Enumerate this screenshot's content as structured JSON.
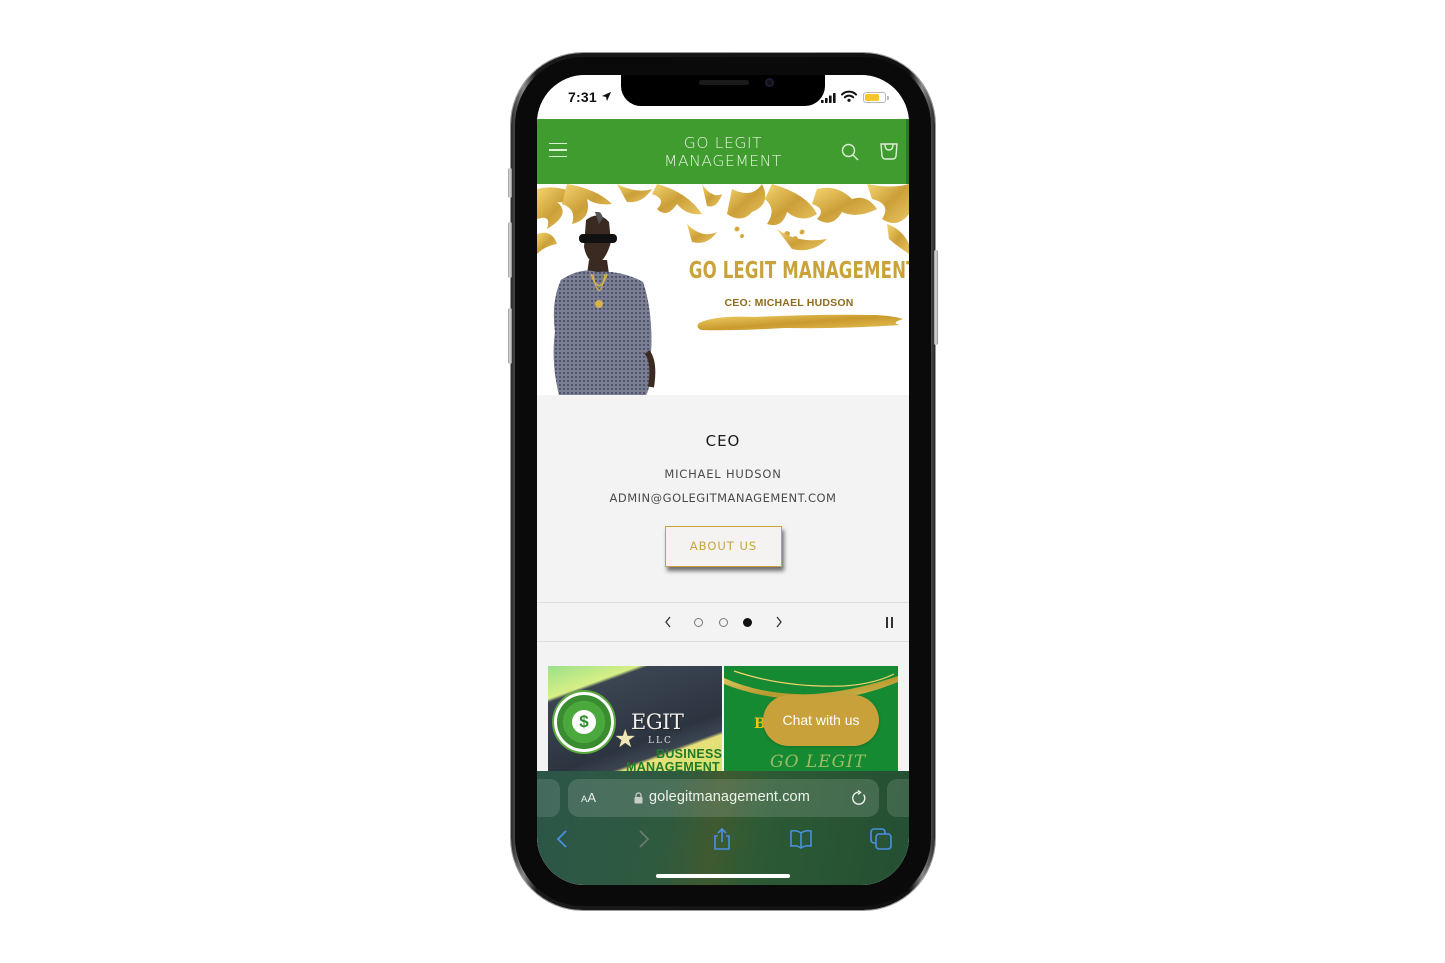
{
  "status_bar": {
    "time": "7:31",
    "location_icon": "location-arrow-icon",
    "signal_icon": "cellular-signal-icon",
    "wifi_icon": "wifi-icon",
    "battery_icon": "battery-icon",
    "battery_color": "#f7c62b"
  },
  "site_header": {
    "title_line1": "GO LEGIT",
    "title_line2": "MANAGEMENT",
    "menu_icon": "hamburger-menu-icon",
    "search_icon": "search-icon",
    "cart_icon": "cart-icon",
    "background_color": "#409c2f"
  },
  "hero": {
    "title": "GO LEGIT MANAGEMENT LLC",
    "subtitle": "CEO: MICHAEL HUDSON",
    "accent_color": "#c9a23a"
  },
  "slide": {
    "heading": "CEO",
    "name": "MICHAEL HUDSON",
    "email": "ADMIN@GOLEGITMANAGEMENT.COM",
    "button_label": "ABOUT US"
  },
  "slider_controls": {
    "prev_icon": "chevron-left-icon",
    "next_icon": "chevron-right-icon",
    "pause_icon": "pause-icon",
    "total_slides": 3,
    "active_slide": 3
  },
  "cards": [
    {
      "title_word": "EGIT",
      "llc": "LLC",
      "line1": "BUSINESS",
      "line2": "MANAGEMENT",
      "icon": "dollar-coin-icon"
    },
    {
      "letter": "B",
      "script": "GO LEGIT"
    }
  ],
  "chat_button": {
    "label": "Chat with us",
    "color": "#c9a13a"
  },
  "safari": {
    "aa_small": "A",
    "aa_large": "A",
    "url": "golegitmanagement.com",
    "lock_icon": "lock-icon",
    "reload_icon": "reload-icon",
    "back_icon": "back-chevron-icon",
    "forward_icon": "forward-chevron-icon",
    "share_icon": "share-icon",
    "bookmarks_icon": "bookmarks-book-icon",
    "tabs_icon": "tabs-icon",
    "accent_color": "#4a90e2"
  }
}
